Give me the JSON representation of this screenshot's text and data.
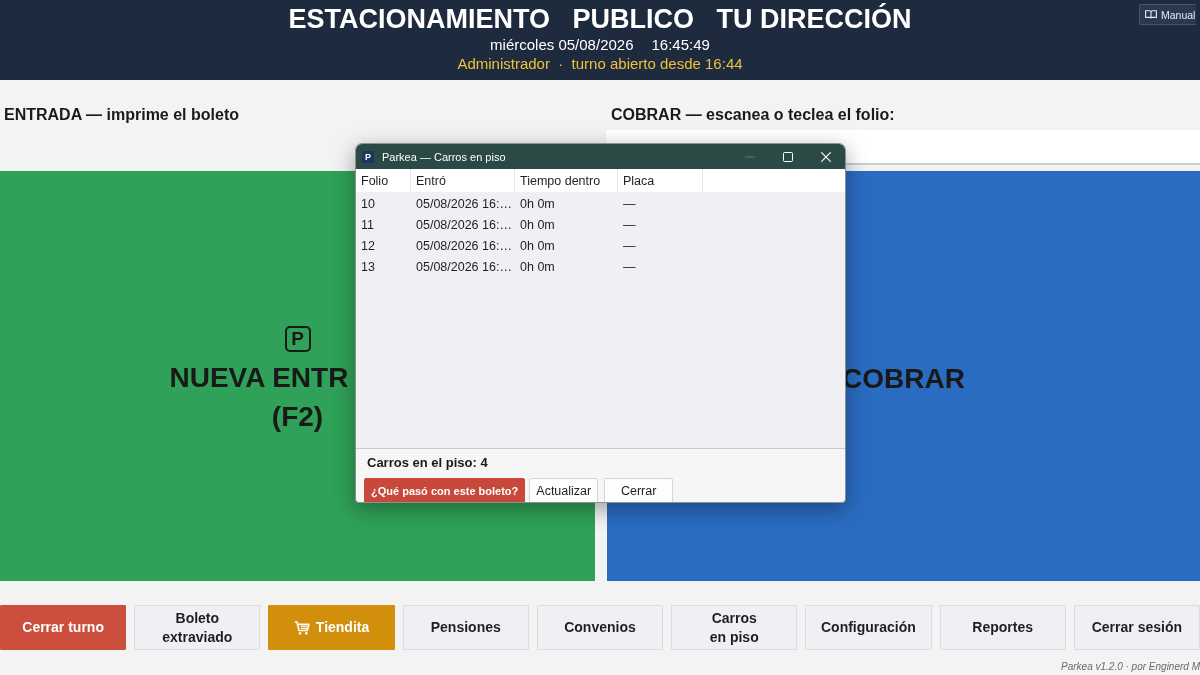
{
  "header": {
    "title": "ESTACIONAMIENTO   PUBLICO   TU DIRECCIÓN",
    "date": "miércoles 05/08/2026",
    "time": "16:45:49",
    "session": "Administrador  ·  turno abierto desde 16:44",
    "manual_button": {
      "label": "Manual"
    }
  },
  "entry_panel": {
    "heading": "ENTRADA — imprime el boleto",
    "button": {
      "symbol": "P",
      "lines": [
        "NUEVA ENTR",
        "(F2)"
      ]
    }
  },
  "checkout_panel": {
    "heading": "COBRAR — escanea o teclea el folio:",
    "button": {
      "label": "COBRAR"
    }
  },
  "dialog": {
    "app_icon": "P",
    "title": "Parkea — Carros en piso",
    "columns": [
      "Folio",
      "Entró",
      "Tiempo dentro",
      "Placa"
    ],
    "rows": [
      {
        "folio": "10",
        "entered": "05/08/2026 16:…",
        "time_inside": "0h 0m",
        "plate": "—"
      },
      {
        "folio": "11",
        "entered": "05/08/2026 16:…",
        "time_inside": "0h 0m",
        "plate": "—"
      },
      {
        "folio": "12",
        "entered": "05/08/2026 16:…",
        "time_inside": "0h 0m",
        "plate": "—"
      },
      {
        "folio": "13",
        "entered": "05/08/2026 16:…",
        "time_inside": "0h 0m",
        "plate": "—"
      }
    ],
    "count": "Carros en el piso: 4",
    "buttons": [
      {
        "label": "¿Qué pasó con este boleto?",
        "kind": "danger"
      },
      {
        "label": "Actualizar",
        "kind": "plain"
      },
      {
        "label": "Cerrar",
        "kind": "plain"
      }
    ]
  },
  "toolbar": {
    "buttons": [
      {
        "label": "Cerrar turno",
        "kind": "danger"
      },
      {
        "label": "Boleto\nextraviado",
        "kind": "plain"
      },
      {
        "label": "Tiendita",
        "kind": "store"
      },
      {
        "label": "Pensiones",
        "kind": "plain"
      },
      {
        "label": "Convenios",
        "kind": "plain"
      },
      {
        "label": "Carros\nen piso",
        "kind": "plain"
      },
      {
        "label": "Configuración",
        "kind": "plain"
      },
      {
        "label": "Reportes",
        "kind": "plain"
      },
      {
        "label": "Cerrar sesión",
        "kind": "plain"
      }
    ]
  },
  "footer": {
    "credit": "Parkea v1.2.0 · por Enginerd M"
  }
}
